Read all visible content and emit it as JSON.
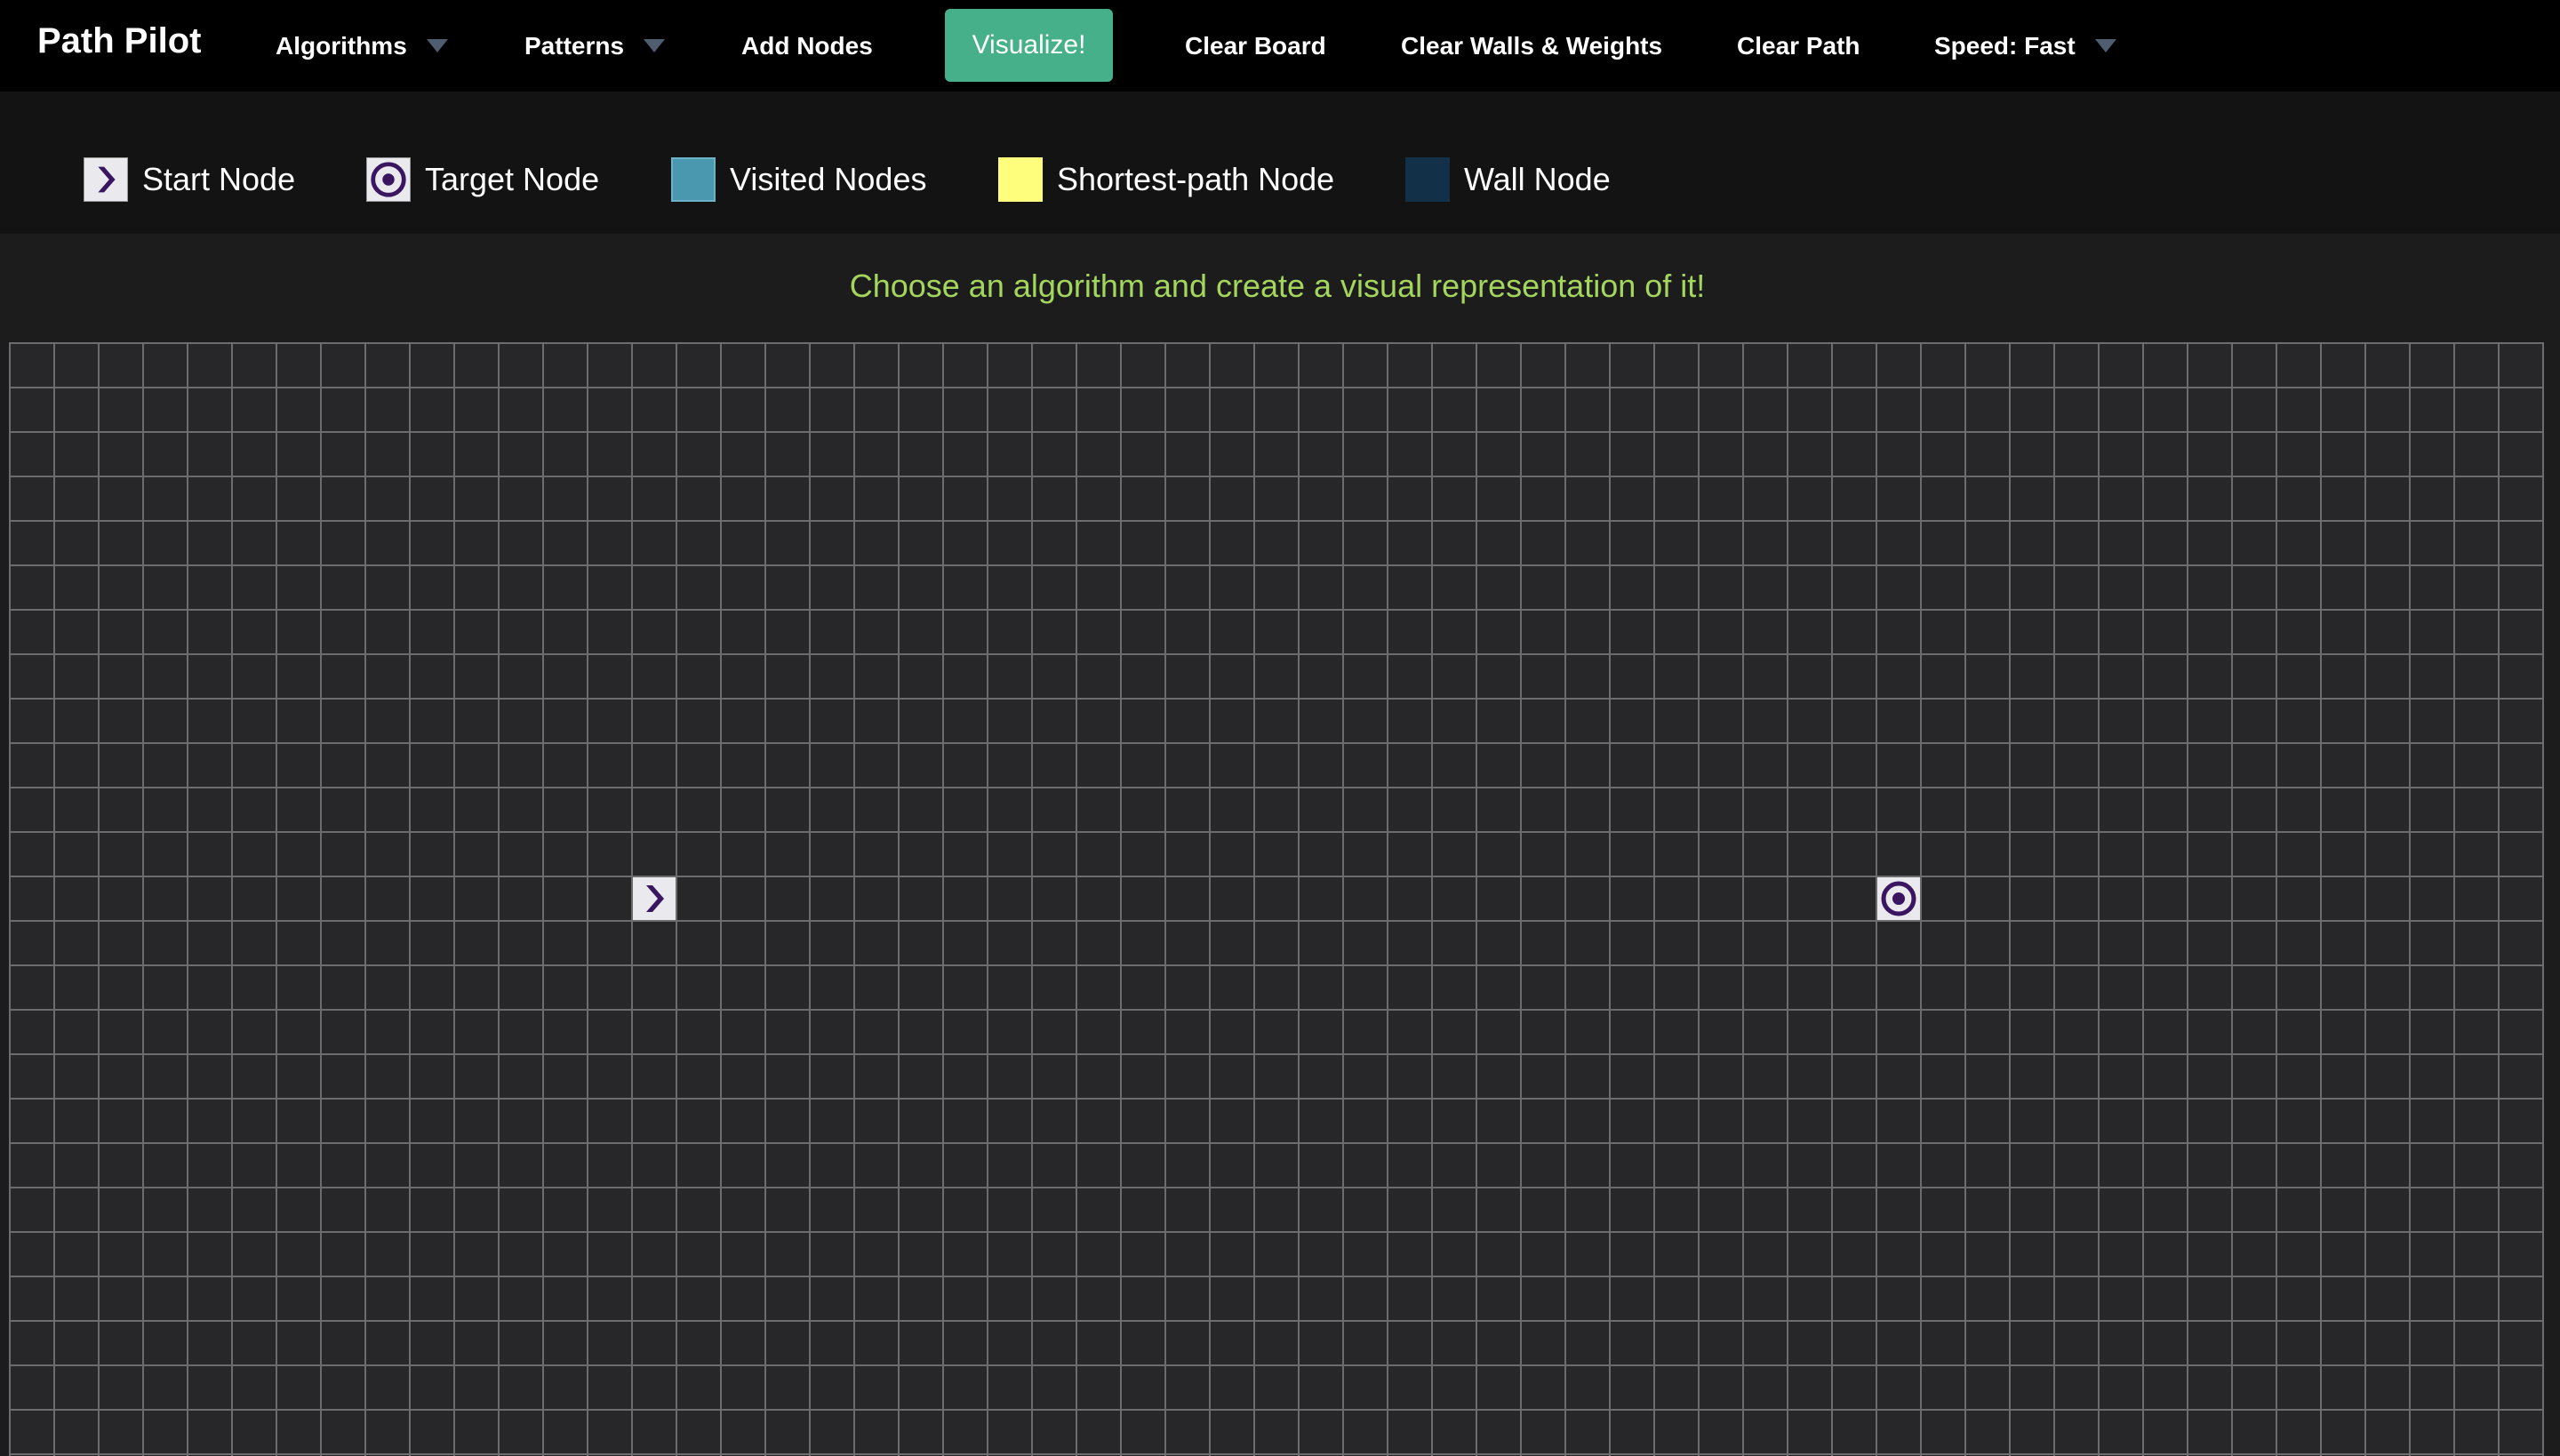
{
  "app": {
    "title": "Path Pilot"
  },
  "navbar": {
    "algorithms": "Algorithms",
    "patterns": "Patterns",
    "add_nodes": "Add Nodes",
    "visualize": "Visualize!",
    "clear_board": "Clear Board",
    "clear_walls_weights": "Clear Walls & Weights",
    "clear_path": "Clear Path",
    "speed": "Speed: Fast"
  },
  "legend": {
    "start": "Start Node",
    "target": "Target Node",
    "visited": "Visited Nodes",
    "shortest_path": "Shortest-path Node",
    "wall": "Wall Node"
  },
  "board": {
    "instructions": "Choose an algorithm and create a visual representation of it!"
  },
  "colors": {
    "accent": "#46b08b",
    "instruction_text": "#a4d65e",
    "node_icon": "#3a1560",
    "visited": "#4a97b0",
    "shortest_path": "#fffe7c",
    "wall": "#133049"
  },
  "icons": {
    "start": "chevron-right-icon",
    "target": "target-icon",
    "dropdown": "caret-down-icon"
  }
}
